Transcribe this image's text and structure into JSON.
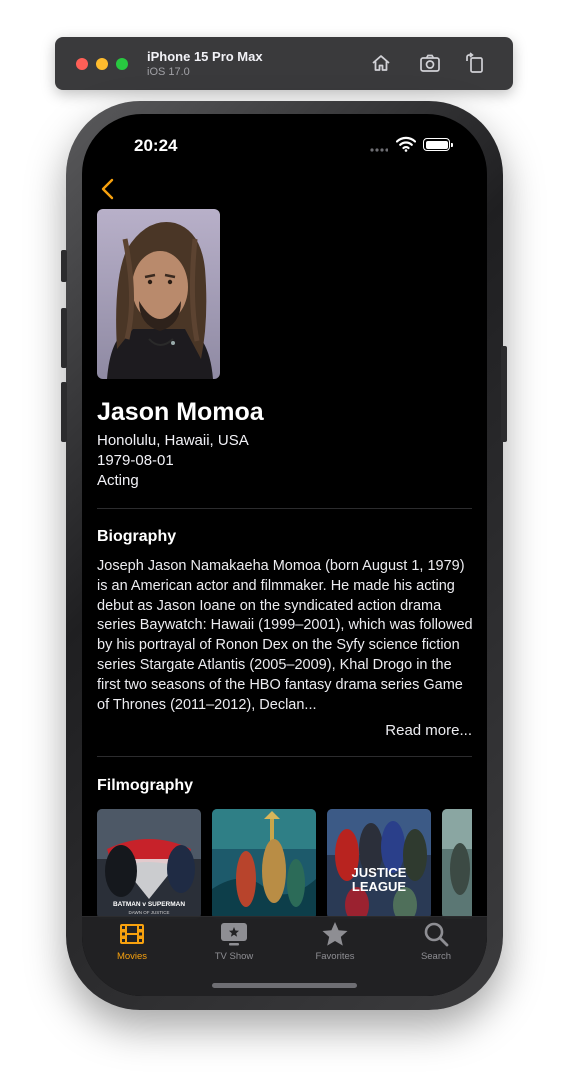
{
  "simulator": {
    "device": "iPhone 15 Pro Max",
    "os": "iOS 17.0",
    "buttons": [
      "home-icon",
      "screenshot-icon",
      "rotate-icon"
    ]
  },
  "status_bar": {
    "time": "20:24"
  },
  "person": {
    "name": "Jason Momoa",
    "birthplace": "Honolulu, Hawaii, USA",
    "birthday": "1979-08-01",
    "department": "Acting"
  },
  "biography": {
    "title": "Biography",
    "text": "Joseph Jason Namakaeha Momoa (born August 1, 1979) is an American actor and filmmaker. He made his acting debut as Jason Ioane on the syndicated action drama series Baywatch: Hawaii (1999–2001), which was followed by his portrayal of Ronon Dex on the Syfy science fiction series Stargate Atlantis (2005–2009), Khal Drogo in the first two seasons of the HBO fantasy drama series Game of Thrones (2011–2012), Declan...",
    "read_more": "Read more..."
  },
  "filmography": {
    "title": "Filmography",
    "posters": [
      {
        "poster_text_top": "BATMAN v SUPERMAN",
        "poster_text_bottom": "DAWN OF JUSTICE"
      },
      {
        "poster_text_top": "",
        "poster_text_bottom": ""
      },
      {
        "poster_text_top": "JUSTICE",
        "poster_text_bottom": "LEAGUE"
      },
      {
        "poster_text_top": "",
        "poster_text_bottom": ""
      }
    ]
  },
  "tabs": [
    {
      "label": "Movies",
      "icon": "film-icon",
      "active": true
    },
    {
      "label": "TV Show",
      "icon": "tv-icon",
      "active": false
    },
    {
      "label": "Favorites",
      "icon": "star-icon",
      "active": false
    },
    {
      "label": "Search",
      "icon": "search-icon",
      "active": false
    }
  ],
  "colors": {
    "accent": "#f7a10e",
    "background": "#000000",
    "tabbar": "#222224"
  }
}
